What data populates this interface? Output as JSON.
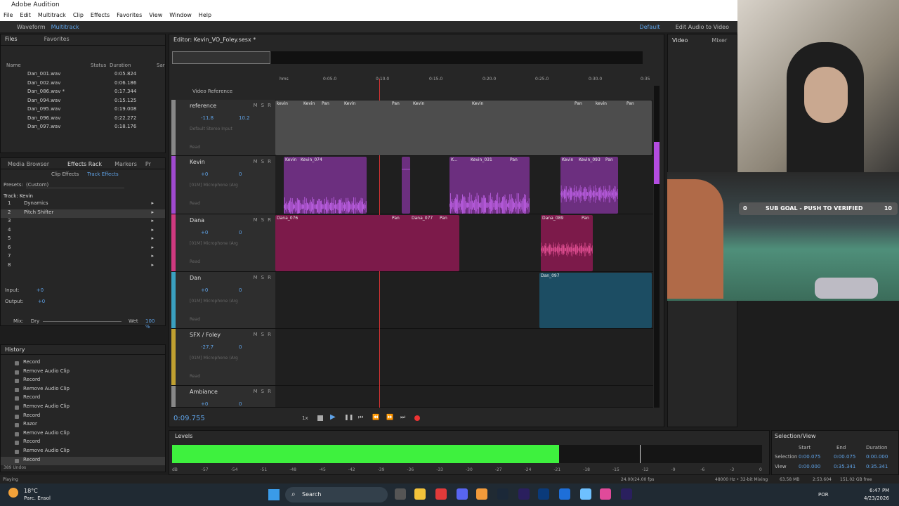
{
  "app": {
    "title": "Adobe Audition"
  },
  "menu": [
    "File",
    "Edit",
    "Multitrack",
    "Clip",
    "Effects",
    "Favorites",
    "View",
    "Window",
    "Help"
  ],
  "toolbar": {
    "waveform": "Waveform",
    "multitrack": "Multitrack",
    "workspace": "Default",
    "edit_audio_video": "Edit Audio to Video"
  },
  "files_panel": {
    "tabs": [
      "Files",
      "Favorites"
    ],
    "cols": {
      "name": "Name",
      "status": "Status",
      "duration": "Duration",
      "sample": "Sar"
    },
    "rows": [
      {
        "name": "Dan_001.wav",
        "dur": "0:05.824"
      },
      {
        "name": "Dan_002.wav",
        "dur": "0:06.186"
      },
      {
        "name": "Dan_086.wav *",
        "dur": "0:17.344"
      },
      {
        "name": "Dan_094.wav",
        "dur": "0:15.125"
      },
      {
        "name": "Dan_095.wav",
        "dur": "0:19.008"
      },
      {
        "name": "Dan_096.wav",
        "dur": "0:22.272"
      },
      {
        "name": "Dan_097.wav",
        "dur": "0:18.176"
      }
    ]
  },
  "effects_panel": {
    "tabs": [
      "Media Browser",
      "Effects Rack",
      "Markers",
      "Pr"
    ],
    "subtabs": [
      "Clip Effects",
      "Track Effects"
    ],
    "presets_label": "Presets:",
    "preset_value": "(Custom)",
    "track_label": "Track: Kevin",
    "slots": [
      {
        "n": "1",
        "name": "Dynamics"
      },
      {
        "n": "2",
        "name": "Pitch Shifter"
      },
      {
        "n": "3",
        "name": ""
      },
      {
        "n": "4",
        "name": ""
      },
      {
        "n": "5",
        "name": ""
      },
      {
        "n": "6",
        "name": ""
      },
      {
        "n": "7",
        "name": ""
      },
      {
        "n": "8",
        "name": ""
      }
    ],
    "input": "Input:",
    "input_val": "+0",
    "output": "Output:",
    "output_val": "+0",
    "mix": "Mix:",
    "dry": "Dry",
    "wet": "Wet",
    "wet_pct": "100 %"
  },
  "history": {
    "title": "History",
    "items": [
      "Record",
      "Remove Audio Clip",
      "Record",
      "Remove Audio Clip",
      "Record",
      "Remove Audio Clip",
      "Record",
      "Razor",
      "Remove Audio Clip",
      "Record",
      "Remove Audio Clip",
      "Record"
    ],
    "undos": "389 Undos"
  },
  "editor": {
    "title": "Editor: Kevin_VO_Foley.sesx *",
    "ruler": [
      "hms",
      "0:05.0",
      "0:10.0",
      "0:15.0",
      "0:20.0",
      "0:25.0",
      "0:30.0",
      "0:35"
    ],
    "video_ref": "Video Reference",
    "tracks": [
      {
        "name": "reference",
        "vol": "-11.8",
        "pan": "10.2",
        "input": "Default Stereo Input",
        "read": "Read"
      },
      {
        "name": "Kevin",
        "vol": "+0",
        "pan": "0",
        "input": "[01M] Microphone (Arg",
        "read": "Read"
      },
      {
        "name": "Dana",
        "vol": "+0",
        "pan": "0",
        "input": "[01M] Microphone (Arg",
        "read": "Read"
      },
      {
        "name": "Dan",
        "vol": "+0",
        "pan": "0",
        "input": "[01M] Microphone (Arg",
        "read": "Read"
      },
      {
        "name": "SFX / Foley",
        "vol": "-27.7",
        "pan": "0",
        "input": "[01M] Microphone (Arg",
        "read": "Read"
      },
      {
        "name": "Ambiance",
        "vol": "+0",
        "pan": "0",
        "input": "",
        "read": ""
      }
    ],
    "clips": {
      "ref": [
        "kevin",
        "Kevin",
        "Pan",
        "Kevin",
        "Pan",
        "Kevin",
        "Kevin",
        "Pan",
        "kevin",
        "Pan"
      ],
      "kevin": [
        "Kevin",
        "Kevin_074",
        "K...",
        "Kevin_031",
        "Pan",
        "Kevin",
        "Kevin_093",
        "Pan"
      ],
      "dana": [
        "Dana_076",
        "Pan",
        "Dana_077",
        "Pan",
        "Dana_089",
        "Pan"
      ],
      "dan": [
        "Dan_097"
      ]
    },
    "time": "0:09.755",
    "speed": "1x"
  },
  "levels": {
    "title": "Levels",
    "ticks": [
      "dB",
      "-57",
      "-54",
      "-51",
      "-48",
      "-45",
      "-42",
      "-39",
      "-36",
      "-33",
      "-30",
      "-27",
      "-24",
      "-21",
      "-18",
      "-15",
      "-12",
      "-9",
      "-6",
      "-3",
      "0"
    ],
    "fill": 0.75
  },
  "selection": {
    "title": "Selection/View",
    "headers": [
      "Start",
      "End",
      "Duration"
    ],
    "selection_label": "Selection",
    "sel": [
      "0:00.075",
      "0:00.075",
      "0:00.000"
    ],
    "view_label": "View",
    "view": [
      "0:00.000",
      "0:35.341",
      "0:35.341"
    ]
  },
  "video_panel": {
    "tabs": [
      "Video",
      "Mixer"
    ]
  },
  "status": {
    "left": "Playing",
    "fps": "24.00/24.00 fps",
    "format": "48000 Hz • 32-bit Mixing",
    "mem": "63.58 MB",
    "dur": "2:53.604",
    "free": "151.02 GB free"
  },
  "stream": {
    "sub_goal": "SUB GOAL - PUSH TO VERIFIED",
    "left_num": "0",
    "right_num": "10"
  },
  "taskbar": {
    "weather_temp": "18°C",
    "weather_desc": "Parc. Ensol",
    "search": "Search",
    "lang": "POR",
    "time": "6:47 PM",
    "date": "4/23/2026"
  },
  "colors": {
    "accent": "#5fa3e8",
    "green": "#3ef13e",
    "kevin": "#6c2f7f",
    "dana": "#7c1a4a",
    "dan": "#1c4d63"
  }
}
